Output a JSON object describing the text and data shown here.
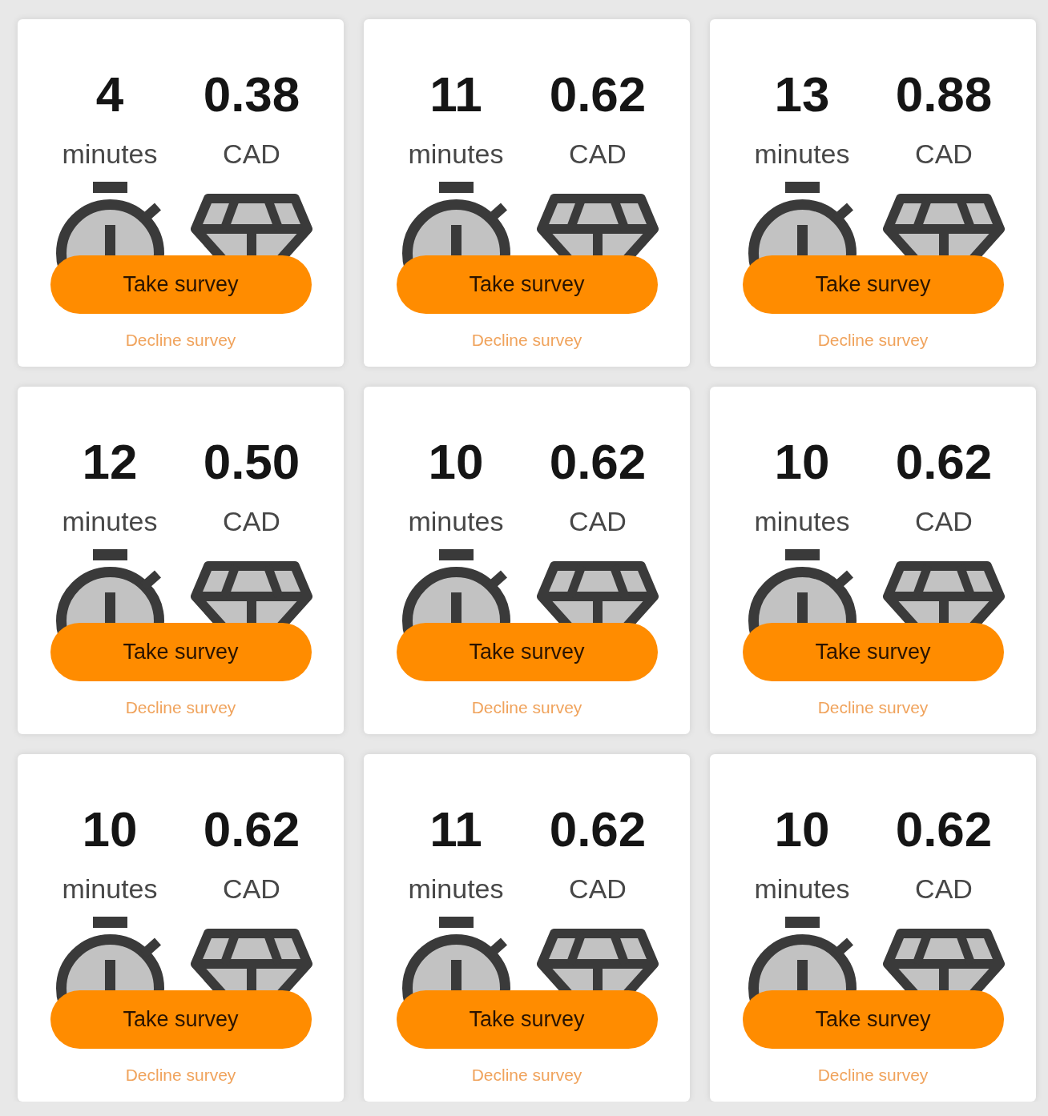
{
  "surveys": [
    {
      "minutes": "4",
      "minutes_unit": "minutes",
      "reward": "0.38",
      "currency": "CAD",
      "take_button": "Take survey",
      "decline_link": "Decline survey"
    },
    {
      "minutes": "11",
      "minutes_unit": "minutes",
      "reward": "0.62",
      "currency": "CAD",
      "take_button": "Take survey",
      "decline_link": "Decline survey"
    },
    {
      "minutes": "13",
      "minutes_unit": "minutes",
      "reward": "0.88",
      "currency": "CAD",
      "take_button": "Take survey",
      "decline_link": "Decline survey"
    },
    {
      "minutes": "12",
      "minutes_unit": "minutes",
      "reward": "0.50",
      "currency": "CAD",
      "take_button": "Take survey",
      "decline_link": "Decline survey"
    },
    {
      "minutes": "10",
      "minutes_unit": "minutes",
      "reward": "0.62",
      "currency": "CAD",
      "take_button": "Take survey",
      "decline_link": "Decline survey"
    },
    {
      "minutes": "10",
      "minutes_unit": "minutes",
      "reward": "0.62",
      "currency": "CAD",
      "take_button": "Take survey",
      "decline_link": "Decline survey"
    },
    {
      "minutes": "10",
      "minutes_unit": "minutes",
      "reward": "0.62",
      "currency": "CAD",
      "take_button": "Take survey",
      "decline_link": "Decline survey"
    },
    {
      "minutes": "11",
      "minutes_unit": "minutes",
      "reward": "0.62",
      "currency": "CAD",
      "take_button": "Take survey",
      "decline_link": "Decline survey"
    },
    {
      "minutes": "10",
      "minutes_unit": "minutes",
      "reward": "0.62",
      "currency": "CAD",
      "take_button": "Take survey",
      "decline_link": "Decline survey"
    }
  ]
}
